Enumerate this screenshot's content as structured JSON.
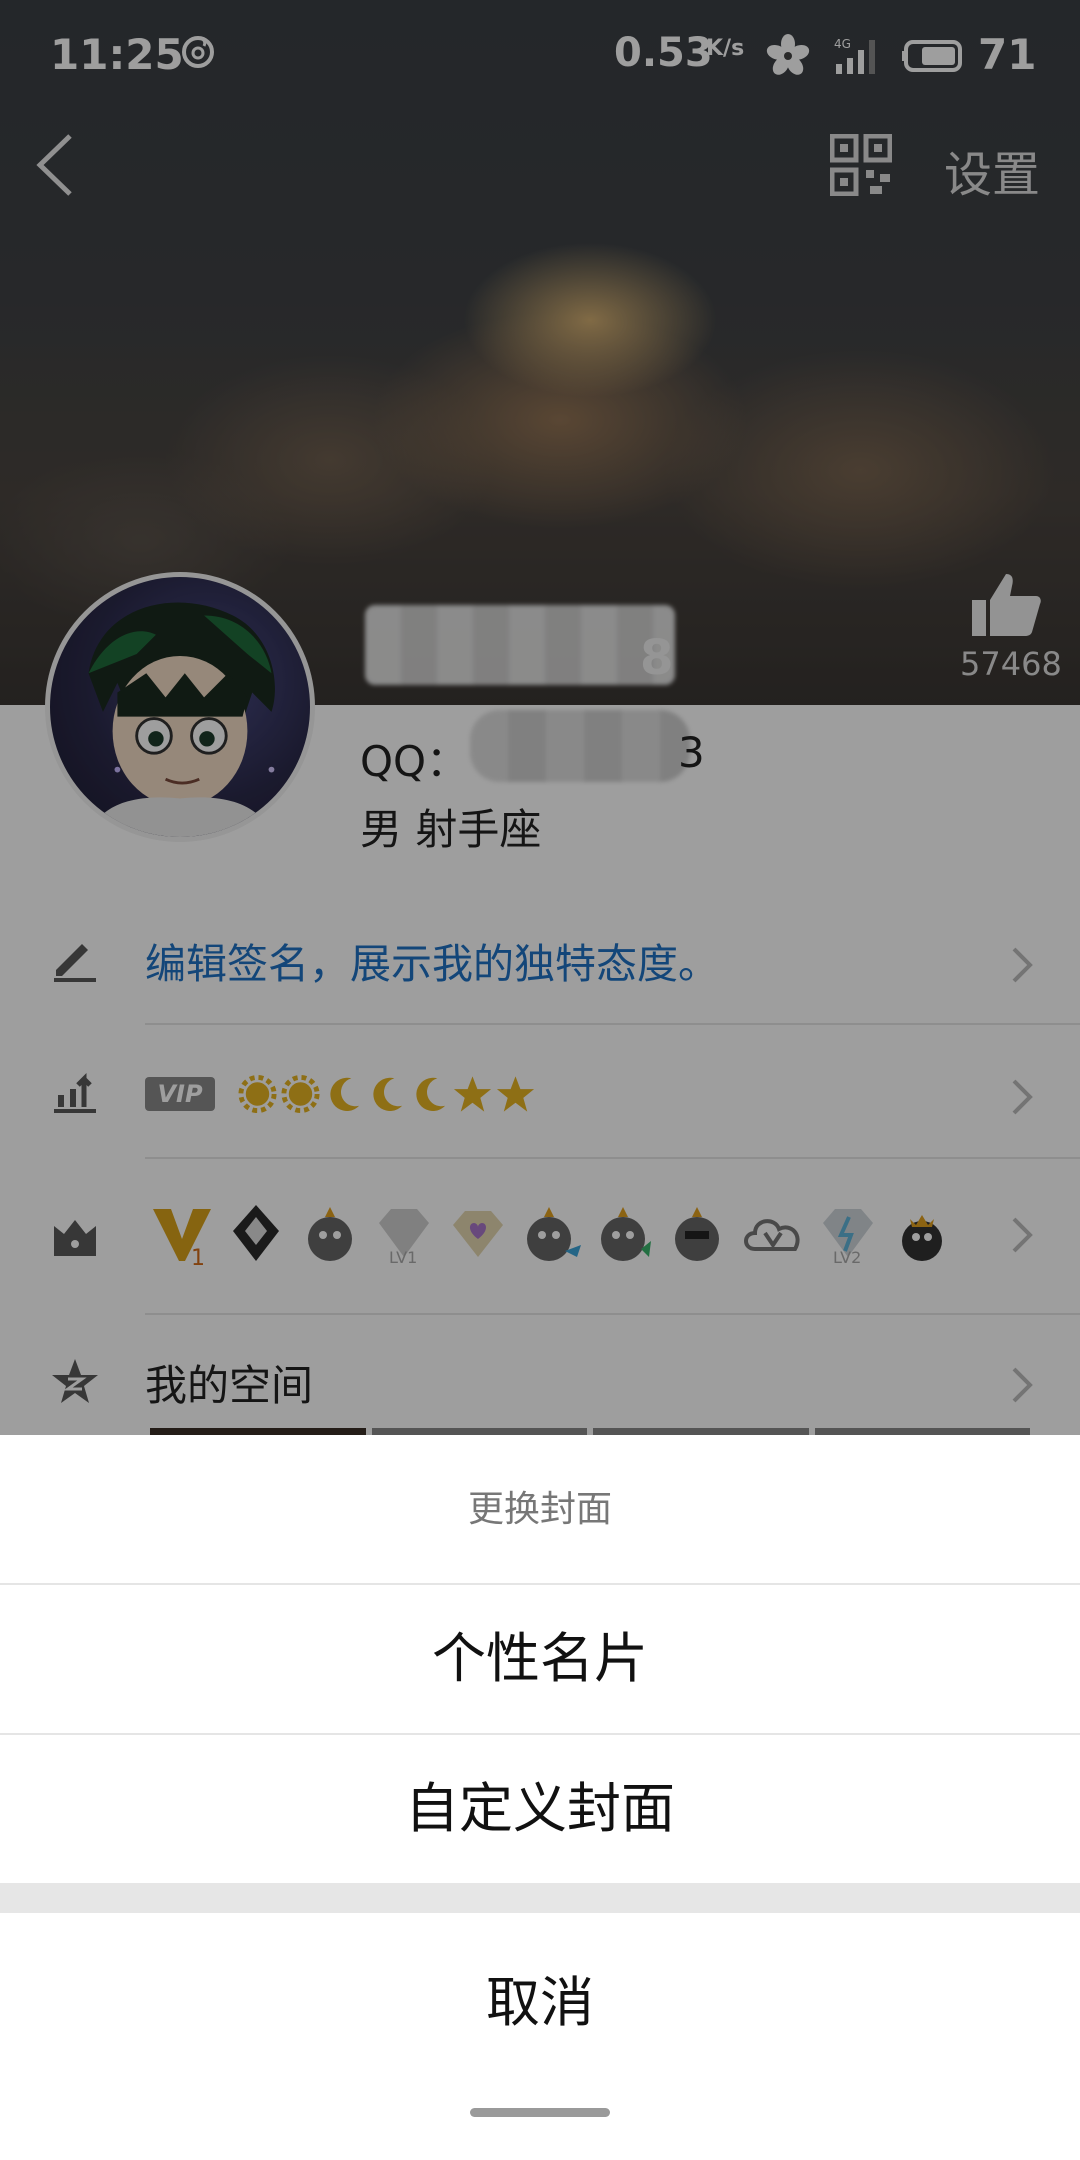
{
  "status_bar": {
    "time": "11:25",
    "network_speed": "0.53",
    "network_unit": "K/s",
    "network_type": "4G",
    "battery": "71"
  },
  "nav": {
    "back_icon": "chevron-left-icon",
    "qr_icon": "qr-code-icon",
    "settings_label": "设置"
  },
  "profile": {
    "likes": "57468",
    "name_visible_suffix": "8",
    "qq_label": "QQ：",
    "qq_visible_suffix": "3",
    "gender_zodiac": "男  射手座"
  },
  "rows": {
    "signature": "编辑签名，展示我的独特态度。",
    "vip_label": "VIP",
    "level_icons": [
      "sun",
      "sun",
      "moon",
      "moon",
      "moon",
      "star",
      "star"
    ],
    "badge_icons": [
      "vip-v1-badge",
      "diamond-dark-badge",
      "qq-penguin-badge",
      "lv1-diamond-badge",
      "purple-heart-diamond-badge",
      "qq-penguin-fish-badge",
      "qq-penguin-green-badge",
      "qq-penguin-glasses-badge",
      "cloud-v-badge",
      "lv2-diamond-badge",
      "qq-penguin-crown-badge"
    ],
    "space_label": "我的空间"
  },
  "action_sheet": {
    "title": "更换封面",
    "option_1": "个性名片",
    "option_2": "自定义封面",
    "cancel": "取消"
  },
  "colors": {
    "signature_blue": "#1f72c4",
    "overlay": "rgba(0,0,0,0.38)"
  }
}
